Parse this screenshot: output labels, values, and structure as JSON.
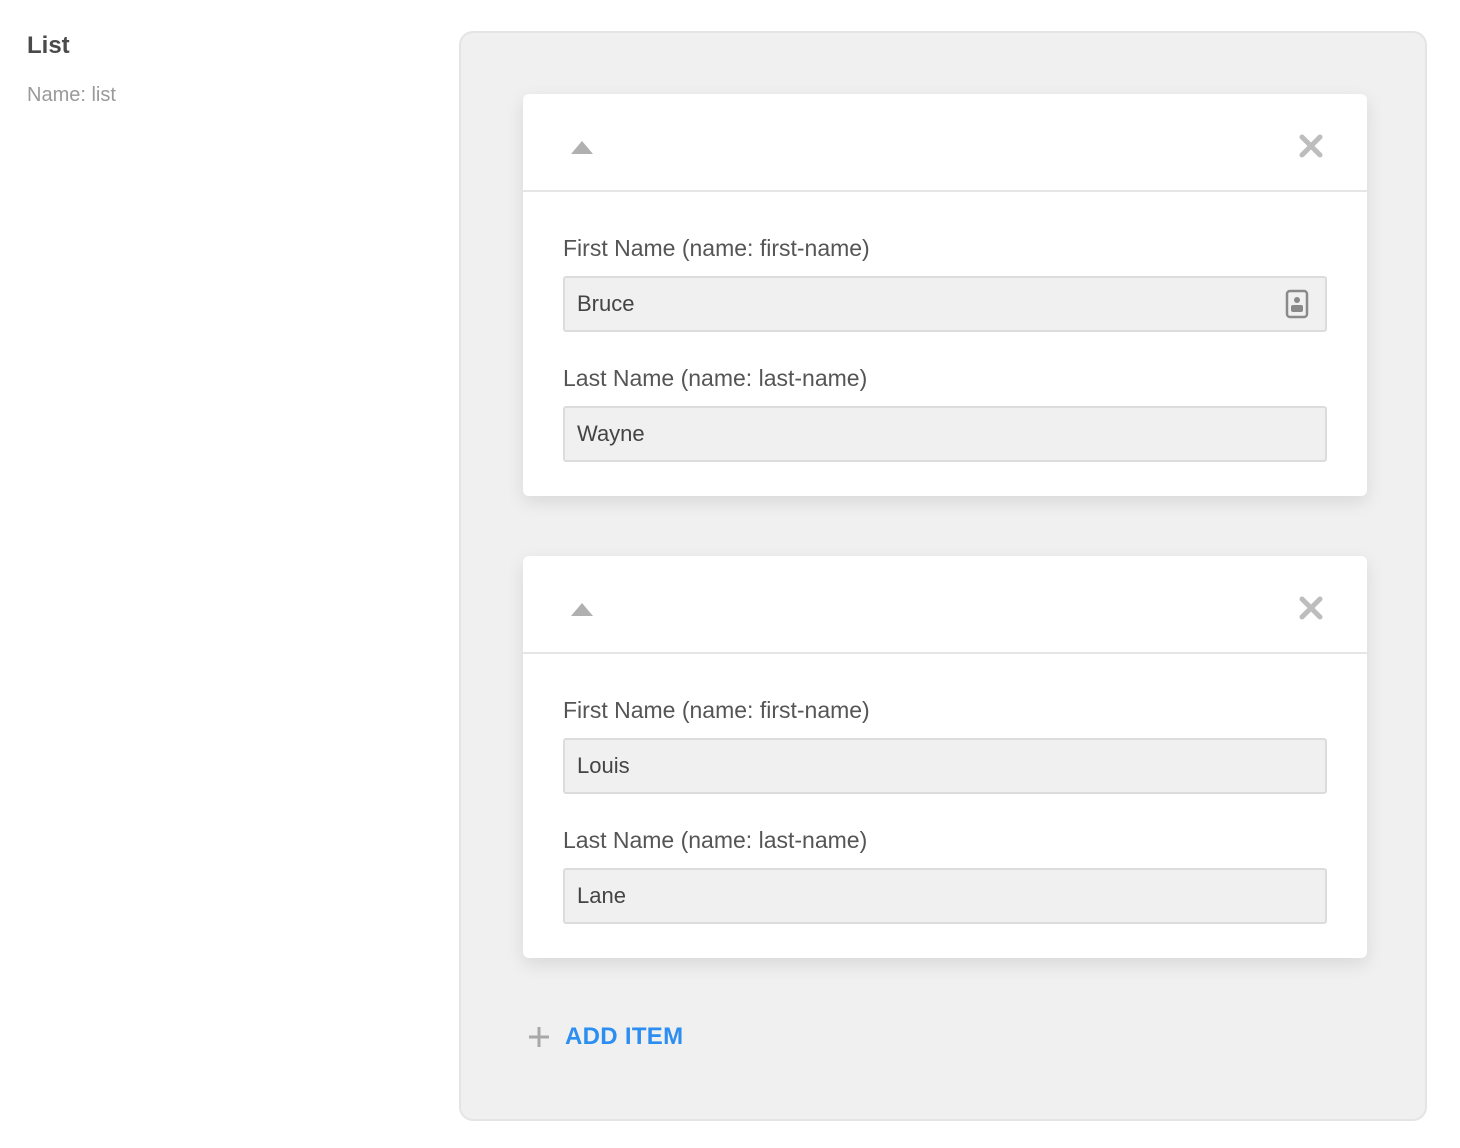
{
  "field": {
    "title": "List",
    "subtitle": "Name: list"
  },
  "items": [
    {
      "first_name_label": "First Name (name: first-name)",
      "first_name_value": "Bruce",
      "last_name_label": "Last Name (name: last-name)",
      "last_name_value": "Wayne"
    },
    {
      "first_name_label": "First Name (name: first-name)",
      "first_name_value": "Louis",
      "last_name_label": "Last Name (name: last-name)",
      "last_name_value": "Lane"
    }
  ],
  "add_item_label": "ADD ITEM",
  "icons": {
    "collapse": "chevron-up-icon",
    "remove": "close-icon",
    "contact": "contact-card-icon",
    "add": "plus-icon"
  },
  "colors": {
    "accent": "#2b8ef0",
    "panel_bg": "#f0f0f0",
    "icon_gray": "#bdbdbd"
  }
}
